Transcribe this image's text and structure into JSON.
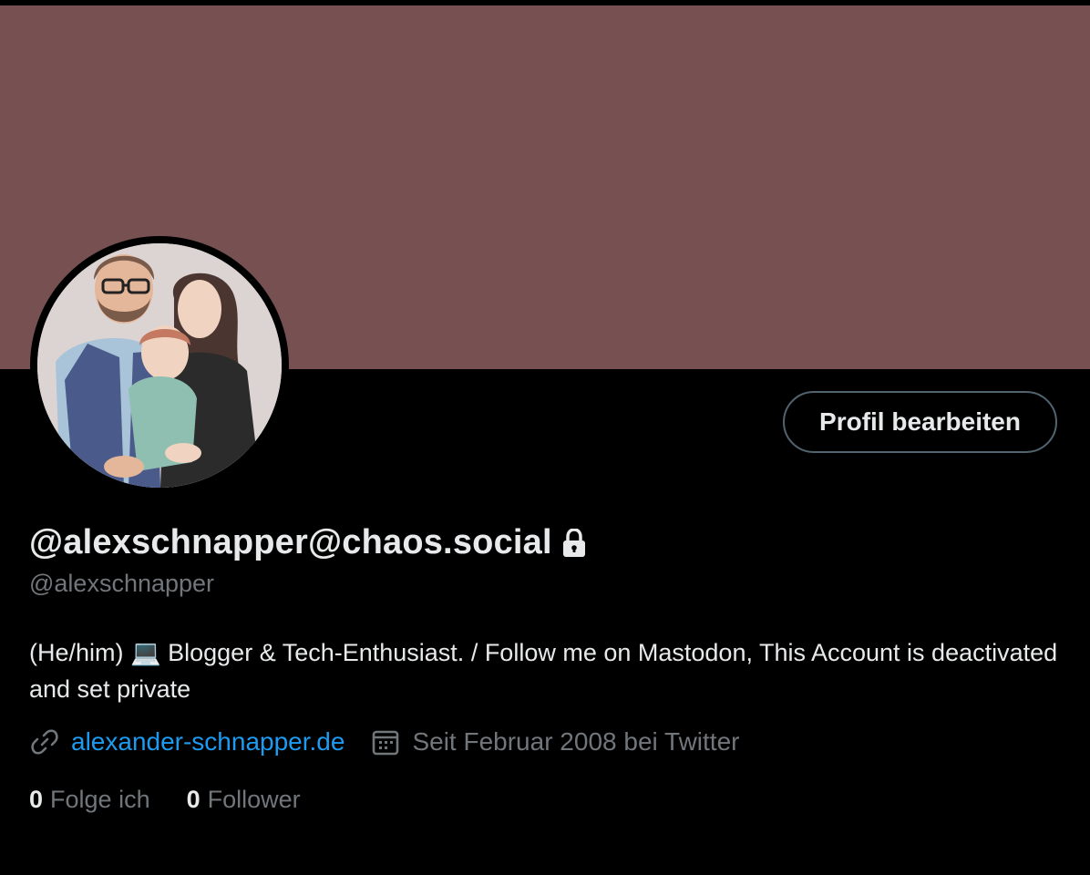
{
  "profile": {
    "display_name": "@alexschnapper@chaos.social",
    "handle": "@alexschnapper",
    "bio": "(He/him) 💻 Blogger & Tech-Enthusiast. / Follow me on Mastodon, This Account is deactivated and set private",
    "website": "alexander-schnapper.de",
    "joined": "Seit Februar 2008 bei Twitter",
    "following_count": "0",
    "following_label": "Folge ich",
    "followers_count": "0",
    "followers_label": "Follower",
    "edit_button_label": "Profil bearbeiten",
    "locked": true
  },
  "icons": {
    "lock": "lock-icon",
    "link": "link-icon",
    "calendar": "calendar-icon"
  },
  "colors": {
    "banner": "#775151",
    "background": "#000000",
    "link": "#1d9bf0",
    "secondary_text": "#71767b",
    "primary_text": "#e7e9ea"
  }
}
